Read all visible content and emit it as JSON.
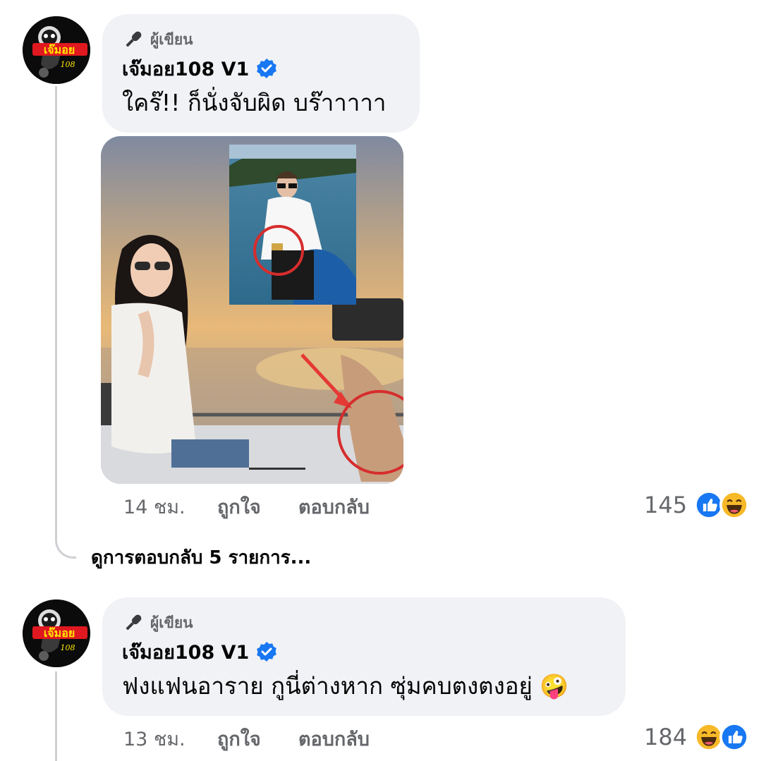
{
  "comments": [
    {
      "author_badge": "ผู้เขียน",
      "author_name": "เจ๊มอย108 V1",
      "text": "ใคร๊!! ก็นั่งจับผิด บร๊าาาาา",
      "time": "14 ชม.",
      "like_label": "ถูกใจ",
      "reply_label": "ตอบกลับ",
      "reaction_count": "145",
      "reactions": [
        "like-icon",
        "haha-icon"
      ]
    },
    {
      "author_badge": "ผู้เขียน",
      "author_name": "เจ๊มอย108 V1",
      "text": "ฟงแฟนอาราย กูนี่ต่างหาก ซุ่มคบตงตงอยู่ 🤪",
      "time": "13 ชม.",
      "like_label": "ถูกใจ",
      "reply_label": "ตอบกลับ",
      "reaction_count": "184",
      "reactions": [
        "haha-icon",
        "like-icon"
      ]
    }
  ],
  "view_replies": "ดูการตอบกลับ 5 รายการ...",
  "avatar": {
    "logo_text": "เจ๊มอย",
    "logo_number": "108"
  },
  "colors": {
    "bubble_bg": "#f0f2f5",
    "meta_text": "#65676b",
    "verified_blue": "#1877f2",
    "like_blue": "#1877f2",
    "haha_yellow": "#f7b928"
  }
}
